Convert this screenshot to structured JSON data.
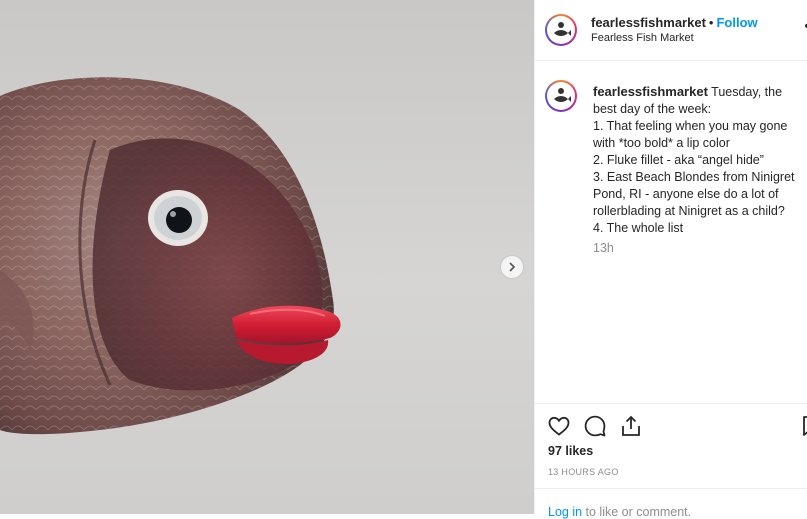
{
  "post": {
    "username": "fearlessfishmarket",
    "separator": "•",
    "follow_label": "Follow",
    "location": "Fearless Fish Market",
    "caption_lines": [
      "Tuesday, the best day of the week:",
      "1. That feeling when you may gone with *too bold* a lip color",
      "2. Fluke fillet - aka “angel hide”",
      "3. East Beach Blondes from Ninigret Pond, RI - anyone else do a lot of rollerblading at Ninigret as a child?",
      "4. The whole list"
    ],
    "caption_time": "13h",
    "likes": "97 likes",
    "posted_ago": "13 HOURS AGO",
    "login_link": "Log in",
    "login_rest": " to like or comment."
  },
  "icons": {
    "like": "heart-icon",
    "comment": "comment-icon",
    "share": "share-icon",
    "save": "bookmark-icon",
    "next": "chevron-right-icon",
    "more": "more-options-icon"
  },
  "colors": {
    "accent": "#0095f6",
    "lips": "#d9233a",
    "muted": "#8e8e8e"
  }
}
